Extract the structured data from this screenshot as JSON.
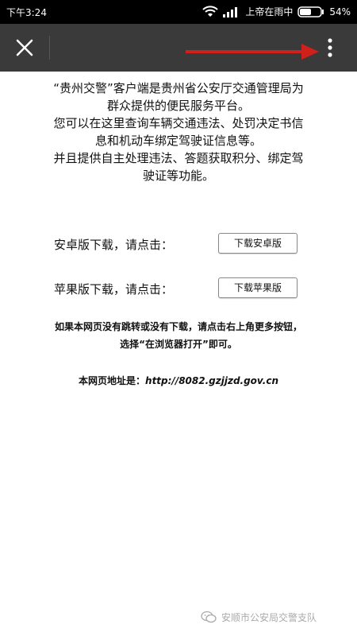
{
  "status_bar": {
    "time": "下午3:24",
    "carrier": "上帝在雨中",
    "battery": "54%",
    "icons": [
      "wifi-icon",
      "signal-icon",
      "battery-icon"
    ]
  },
  "app_bar": {
    "close_icon": "close-icon",
    "more_icon": "more-vertical-icon",
    "arrow_color": "#d0201c"
  },
  "intro": {
    "line1": "“贵州交警”客户端是贵州省公安厅交通管理局为",
    "line2": "群众提供的便民服务平台。",
    "line3": "您可以在这里查询车辆交通违法、处罚决定书信",
    "line4": "息和机动车绑定驾驶证信息等。",
    "line5": "并且提供自主处理违法、答题获取积分、绑定驾",
    "line6": "驶证等功能。"
  },
  "android": {
    "label": "安卓版下载，请点击：",
    "button": "下载安卓版"
  },
  "ios": {
    "label": "苹果版下载，请点击：",
    "button": "下载苹果版"
  },
  "notice": {
    "line1": "如果本网页没有跳转或没有下载，请点击右上角更多按钮，",
    "line2": "选择“在浏览器打开”即可。"
  },
  "address": {
    "label": "本网页地址是：",
    "url": "http://8082.gzjjzd.gov.cn"
  },
  "watermark": {
    "text": "安顺市公安局交警支队",
    "icon": "wechat-icon"
  }
}
